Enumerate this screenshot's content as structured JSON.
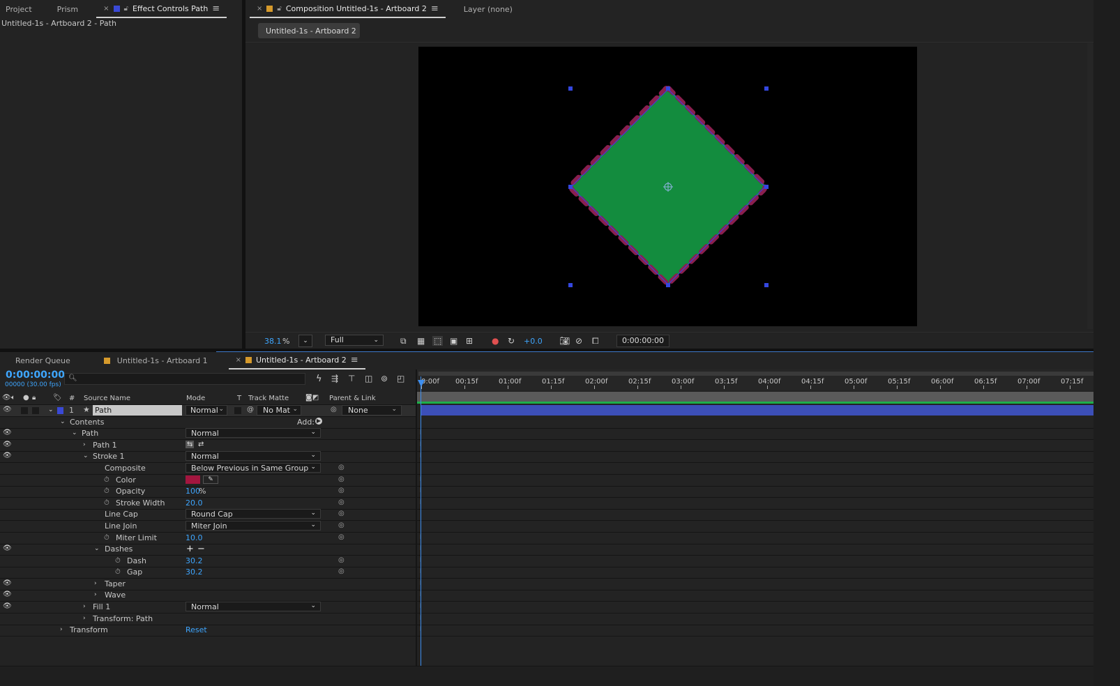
{
  "top_left_panel": {
    "tabs": [
      {
        "label": "Project"
      },
      {
        "label": "Prism"
      },
      {
        "label": "Effect Controls Path",
        "active": true
      }
    ],
    "subtitle": "Untitled-1s - Artboard 2 - Path"
  },
  "viewer": {
    "tabs": [
      {
        "label": "Composition Untitled-1s - Artboard 2",
        "active": true
      },
      {
        "label": "Layer (none)"
      }
    ],
    "breadcrumb": "Untitled-1s - Artboard 2",
    "zoom": "38.1",
    "zoom_unit": "%",
    "resolution": "Full",
    "exposure": "+0.0",
    "timecode": "0:00:00:00",
    "shape_fill_color": "#138c3e",
    "stroke_color": "#8a1f4f",
    "handle_color": "#3447e0"
  },
  "timeline": {
    "tabs": [
      {
        "label": "Render Queue"
      },
      {
        "label": "Untitled-1s - Artboard 1"
      },
      {
        "label": "Untitled-1s - Artboard 2",
        "active": true
      }
    ],
    "current_time": "0:00:00:00",
    "frame_info": "00000 (30.00 fps)",
    "search_placeholder": "",
    "columns": {
      "num": "#",
      "source_name": "Source Name",
      "mode": "Mode",
      "t": "T",
      "track_matte": "Track Matte",
      "parent_link": "Parent & Link"
    },
    "layer": {
      "index": "1",
      "name": "Path",
      "mode": "Normal",
      "track_matte": "No Mat",
      "parent": "None"
    },
    "add_label": "Add:",
    "props": {
      "contents": "Contents",
      "path": "Path",
      "path_mode": "Normal",
      "path1": "Path 1",
      "stroke1": "Stroke 1",
      "stroke1_mode": "Normal",
      "composite": "Composite",
      "composite_value": "Below Previous in Same Group",
      "color": "Color",
      "color_value": "#a3163f",
      "opacity": "Opacity",
      "opacity_value": "100",
      "opacity_unit": "%",
      "stroke_width": "Stroke Width",
      "stroke_width_value": "20.0",
      "line_cap": "Line Cap",
      "line_cap_value": "Round Cap",
      "line_join": "Line Join",
      "line_join_value": "Miter Join",
      "miter_limit": "Miter Limit",
      "miter_limit_value": "10.0",
      "dashes": "Dashes",
      "dash": "Dash",
      "dash_value": "30.2",
      "gap": "Gap",
      "gap_value": "30.2",
      "taper": "Taper",
      "wave": "Wave",
      "fill1": "Fill 1",
      "fill1_mode": "Normal",
      "transform_path": "Transform: Path",
      "transform": "Transform",
      "reset": "Reset"
    },
    "ruler": [
      "0:00f",
      "00:15f",
      "01:00f",
      "01:15f",
      "02:00f",
      "02:15f",
      "03:00f",
      "03:15f",
      "04:00f",
      "04:15f",
      "05:00f",
      "05:15f",
      "06:00f",
      "06:15f",
      "07:00f",
      "07:15f"
    ],
    "layer_bar_color": "#3c4fb8"
  }
}
